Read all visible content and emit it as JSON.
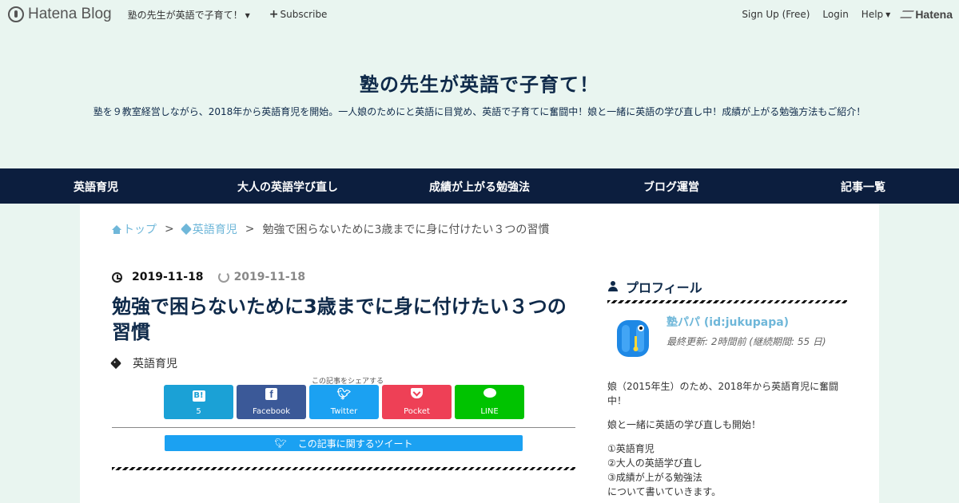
{
  "topbar": {
    "brand": "Hatena Blog",
    "blog_menu": "塾の先生が英語で子育て！",
    "subscribe": "Subscribe",
    "signup": "Sign Up (Free)",
    "login": "Login",
    "help": "Help",
    "hatena": "Hatena"
  },
  "header": {
    "title": "塾の先生が英語で子育て！",
    "description": "塾を９教室経営しながら、2018年から英語育児を開始。一人娘のためにと英語に目覚め、英語で子育てに奮闘中！娘と一緒に英語の学び直し中！成績が上がる勉強方法もご紹介！"
  },
  "nav": [
    {
      "label": "英語育児"
    },
    {
      "label": "大人の英語学び直し"
    },
    {
      "label": "成績が上がる勉強法"
    },
    {
      "label": "ブログ運営"
    },
    {
      "label": "記事一覧"
    }
  ],
  "breadcrumb": {
    "top": "トップ",
    "category": "英語育児",
    "current": "勉強で困らないために3歳までに身に付けたい３つの習慣",
    "sep": ">"
  },
  "entry": {
    "published": "2019-11-18",
    "updated": "2019-11-18",
    "title": "勉強で困らないために3歳までに身に付けたい３つの習慣",
    "category": "英語育児"
  },
  "share": {
    "caption": "この記事をシェアする",
    "hatena_count": "5",
    "facebook": "Facebook",
    "twitter": "Twitter",
    "pocket": "Pocket",
    "line": "LINE",
    "tweet_label": "この記事に関するツイート"
  },
  "sidebar": {
    "title": "プロフィール",
    "name": "塾パパ (id:jukupapa)",
    "meta": "最終更新: 2時間前 (継続期間: 55 日)",
    "para1": "娘（2015年生）のため、2018年から英語育児に奮闘中！",
    "para2": "娘と一緒に英語の学び直しも開始！",
    "list": [
      "①英語育児",
      "②大人の英語学び直し",
      "③成績が上がる勉強法",
      "について書いていきます。"
    ]
  }
}
